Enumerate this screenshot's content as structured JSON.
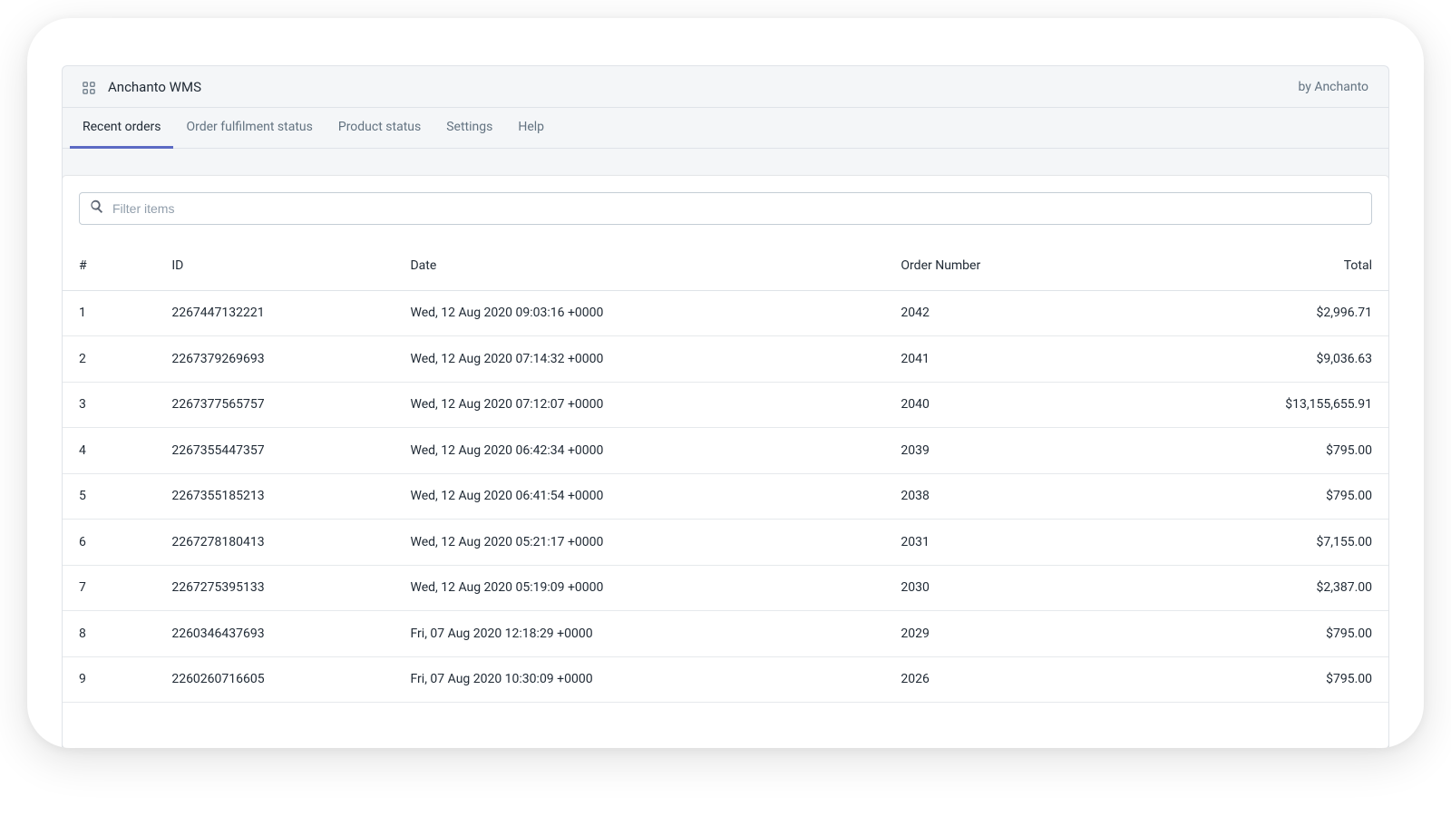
{
  "header": {
    "app_title": "Anchanto WMS",
    "by_label": "by Anchanto",
    "app_icon": "apps-icon"
  },
  "tabs": [
    {
      "label": "Recent orders",
      "active": true
    },
    {
      "label": "Order fulfilment status",
      "active": false
    },
    {
      "label": "Product status",
      "active": false
    },
    {
      "label": "Settings",
      "active": false
    },
    {
      "label": "Help",
      "active": false
    }
  ],
  "filter": {
    "placeholder": "Filter items",
    "value": ""
  },
  "columns": {
    "index": "#",
    "id": "ID",
    "date": "Date",
    "order_number": "Order Number",
    "total": "Total"
  },
  "rows": [
    {
      "index": "1",
      "id": "2267447132221",
      "date": "Wed, 12 Aug 2020 09:03:16 +0000",
      "order_number": "2042",
      "total": "$2,996.71"
    },
    {
      "index": "2",
      "id": "2267379269693",
      "date": "Wed, 12 Aug 2020 07:14:32 +0000",
      "order_number": "2041",
      "total": "$9,036.63"
    },
    {
      "index": "3",
      "id": "2267377565757",
      "date": "Wed, 12 Aug 2020 07:12:07 +0000",
      "order_number": "2040",
      "total": "$13,155,655.91"
    },
    {
      "index": "4",
      "id": "2267355447357",
      "date": "Wed, 12 Aug 2020 06:42:34 +0000",
      "order_number": "2039",
      "total": "$795.00"
    },
    {
      "index": "5",
      "id": "2267355185213",
      "date": "Wed, 12 Aug 2020 06:41:54 +0000",
      "order_number": "2038",
      "total": "$795.00"
    },
    {
      "index": "6",
      "id": "2267278180413",
      "date": "Wed, 12 Aug 2020 05:21:17 +0000",
      "order_number": "2031",
      "total": "$7,155.00"
    },
    {
      "index": "7",
      "id": "2267275395133",
      "date": "Wed, 12 Aug 2020 05:19:09 +0000",
      "order_number": "2030",
      "total": "$2,387.00"
    },
    {
      "index": "8",
      "id": "2260346437693",
      "date": "Fri, 07 Aug 2020 12:18:29 +0000",
      "order_number": "2029",
      "total": "$795.00"
    },
    {
      "index": "9",
      "id": "2260260716605",
      "date": "Fri, 07 Aug 2020 10:30:09 +0000",
      "order_number": "2026",
      "total": "$795.00"
    }
  ]
}
